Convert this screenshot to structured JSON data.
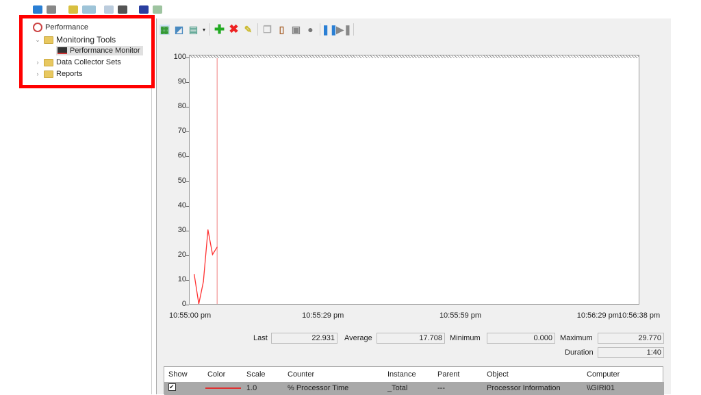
{
  "toolbar_top": {
    "icons": [
      "back-icon",
      "forward-icon",
      "up-folder-icon",
      "show-hide-tree-icon",
      "properties-icon",
      "export-icon",
      "help-icon",
      "show-action-pane-icon"
    ]
  },
  "tree": {
    "root": "Performance",
    "items": [
      {
        "label": "Monitoring Tools",
        "expanded": true,
        "children": [
          {
            "label": "Performance Monitor",
            "selected": true
          }
        ]
      },
      {
        "label": "Data Collector Sets",
        "expanded": false
      },
      {
        "label": "Reports",
        "expanded": false
      }
    ]
  },
  "highlight_color": "#ff0000",
  "chart_toolbar": {
    "icons": [
      "view-graph-icon",
      "view-current-activity-icon",
      "change-graph-type-icon",
      "add-counter-icon",
      "delete-counter-icon",
      "highlight-icon",
      "copy-properties-icon",
      "paste-counter-list-icon",
      "properties-icon",
      "zoom-icon",
      "freeze-display-icon",
      "update-data-icon"
    ]
  },
  "chart_data": {
    "type": "line",
    "ylim": [
      0,
      100
    ],
    "yticks": [
      "100",
      "90",
      "80",
      "70",
      "60",
      "50",
      "40",
      "30",
      "20",
      "10",
      "0"
    ],
    "xticks": [
      "10:55:00 pm",
      "10:55:29 pm",
      "10:55:59 pm",
      "10:56:29 pm",
      "10:56:38 pm"
    ],
    "xtick_seconds": [
      0,
      29,
      59,
      89,
      98
    ],
    "x_range_seconds": [
      0,
      98
    ],
    "series": [
      {
        "color": "#ff3030",
        "x_seconds": [
          1,
          2,
          3,
          4,
          5,
          6
        ],
        "values": [
          12,
          0,
          9,
          30,
          20,
          23
        ]
      }
    ],
    "cursor_seconds": 6,
    "grid": false
  },
  "stats": {
    "last_label": "Last",
    "last": "22.931",
    "average_label": "Average",
    "average": "17.708",
    "minimum_label": "Minimum",
    "minimum": "0.000",
    "maximum_label": "Maximum",
    "maximum": "29.770",
    "duration_label": "Duration",
    "duration": "1:40"
  },
  "counters": {
    "headers": [
      "Show",
      "Color",
      "Scale",
      "Counter",
      "Instance",
      "Parent",
      "Object",
      "Computer"
    ],
    "rows": [
      {
        "show": true,
        "color": "#e03030",
        "scale": "1.0",
        "counter": "% Processor Time",
        "instance": "_Total",
        "parent": "---",
        "object": "Processor Information",
        "computer": "\\\\GIRI01"
      }
    ]
  }
}
